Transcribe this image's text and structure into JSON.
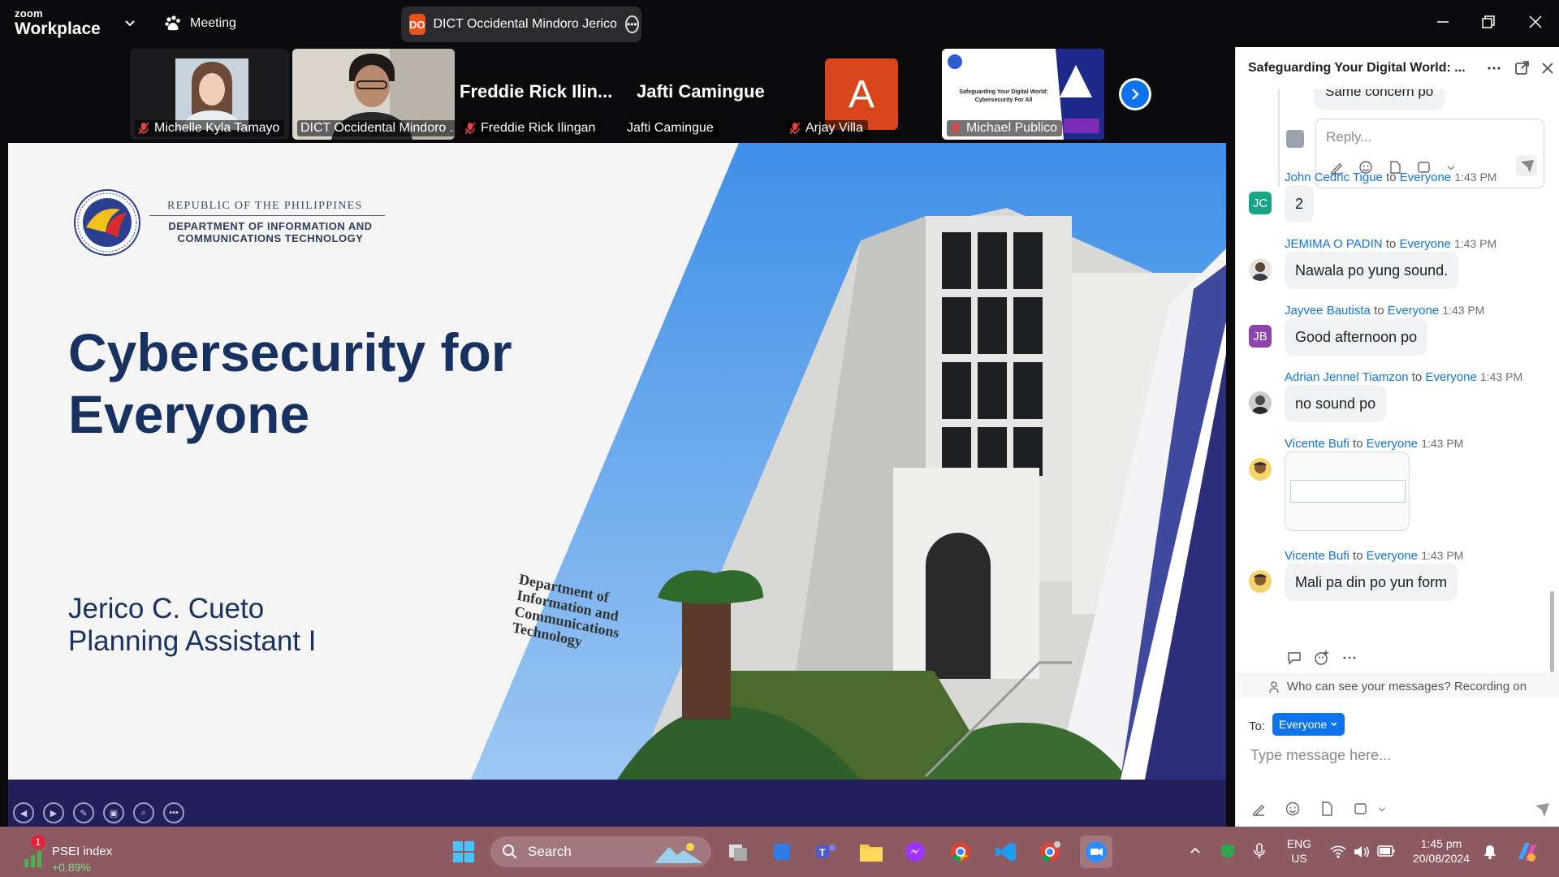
{
  "app": {
    "logo_small": "zoom",
    "logo_big": "Workplace",
    "meeting_label": "Meeting",
    "meeting_title": "DICT Occidental Mindoro Jerico",
    "meeting_initials": "DO"
  },
  "gallery": {
    "tiles": [
      {
        "name": "Michelle Kyla Tamayo"
      },
      {
        "name": "DICT Occidental Mindoro ..."
      },
      {
        "name": "Freddie Rick Ilingan",
        "big": "Freddie  Rick  Ilin..."
      },
      {
        "name": "Jafti Camingue",
        "big": "Jafti Camingue"
      },
      {
        "name": "Arjay Villa",
        "initial": "A"
      },
      {
        "name": "Michael Publico",
        "thumb_line1": "Safeguarding Your Digital World:",
        "thumb_line2": "Cybersecurity For All"
      }
    ]
  },
  "slide": {
    "gov_line1": "REPUBLIC OF THE PHILIPPINES",
    "gov_line2": "DEPARTMENT OF INFORMATION AND",
    "gov_line3": "COMMUNICATIONS TECHNOLOGY",
    "title_line1": "Cybersecurity for",
    "title_line2": "Everyone",
    "presenter_name": "Jerico C. Cueto",
    "presenter_role": "Planning Assistant I",
    "building_sign": [
      "Department of",
      "Information and",
      "Communications",
      "Technology"
    ]
  },
  "chat": {
    "title": "Safeguarding Your Digital World: ...",
    "prev_reply": "Same concern po",
    "reply_placeholder": "Reply...",
    "messages": [
      {
        "sender": "John Cedric Tigue",
        "to": "to",
        "recipient": "Everyone",
        "time": "1:43 PM",
        "text": "2",
        "initials": "JC",
        "color": "#17a589"
      },
      {
        "sender": "JEMIMA O PADIN",
        "to": "to",
        "recipient": "Everyone",
        "time": "1:43 PM",
        "text": "Nawala po yung sound.",
        "initials": "",
        "color": "#5b4636"
      },
      {
        "sender": "Jayvee Bautista",
        "to": "to",
        "recipient": "Everyone",
        "time": "1:43 PM",
        "text": "Good afternoon po",
        "initials": "JB",
        "color": "#8e44ad"
      },
      {
        "sender": "Adrian Jennel Tiamzon",
        "to": "to",
        "recipient": "Everyone",
        "time": "1:43 PM",
        "text": "no sound po",
        "initials": "",
        "color": "#4a4a4a"
      },
      {
        "sender": "Vicente Bufi",
        "to": "to",
        "recipient": "Everyone",
        "time": "1:43 PM",
        "text": "",
        "initials": "",
        "color": "#c59b1b"
      },
      {
        "sender": "Vicente Bufi",
        "to": "to",
        "recipient": "Everyone",
        "time": "1:43 PM",
        "text": "Mali pa din po yun form",
        "initials": "",
        "color": "#c59b1b"
      }
    ],
    "visibility_notice": "Who can see your messages? Recording on",
    "to_label": "To:",
    "to_value": "Everyone",
    "input_placeholder": "Type message here..."
  },
  "taskbar": {
    "stock_badge": "1",
    "stock_name": "PSEI index",
    "stock_change": "+0.89%",
    "search_label": "Search",
    "lang_line1": "ENG",
    "lang_line2": "US",
    "time": "1:45 pm",
    "date": "20/08/2024"
  }
}
